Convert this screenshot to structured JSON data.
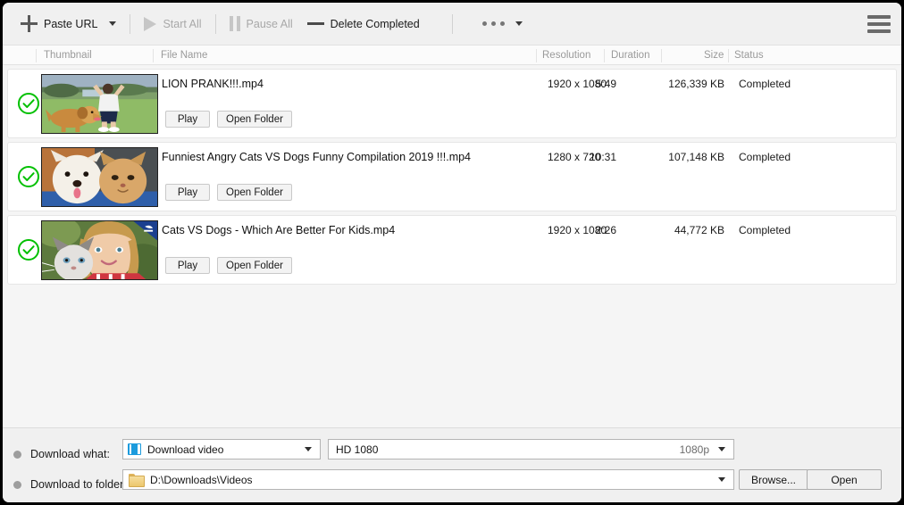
{
  "toolbar": {
    "paste_url": "Paste URL",
    "start_all": "Start All",
    "pause_all": "Pause All",
    "delete_completed": "Delete Completed",
    "plus_icon": "plus-icon",
    "play_icon": "play-icon",
    "pause_icon": "pause-icon",
    "minus_icon": "minus-icon",
    "overflow_icon": "more-dots-icon",
    "menu_icon": "hamburger-menu-icon"
  },
  "columns": {
    "thumbnail": "Thumbnail",
    "file_name": "File Name",
    "resolution": "Resolution",
    "duration": "Duration",
    "size": "Size",
    "status": "Status"
  },
  "row_actions": {
    "play": "Play",
    "open_folder": "Open Folder",
    "status_icon": "check-circle-icon"
  },
  "downloads": [
    {
      "file_name": "LION PRANK!!!.mp4",
      "resolution": "1920 x 1080",
      "duration": "5:49",
      "size": "126,339 KB",
      "status": "Completed",
      "thumbnail_alt": "dog-running-with-person"
    },
    {
      "file_name": "Funniest Angry Cats VS Dogs Funny Compilation 2019 !!!.mp4",
      "resolution": "1280 x 720",
      "duration": "10:31",
      "size": "107,148 KB",
      "status": "Completed",
      "thumbnail_alt": "white-dog-and-ginger-cat"
    },
    {
      "file_name": "Cats VS Dogs - Which Are Better For Kids.mp4",
      "resolution": "1920 x 1080",
      "duration": "2:26",
      "size": "44,772 KB",
      "status": "Completed",
      "thumbnail_alt": "girl-hugging-kitten"
    }
  ],
  "bottom": {
    "download_what_label": "Download what:",
    "download_to_folder_label": "Download to folder:",
    "media_type": "Download video",
    "media_type_icon": "film-strip-icon",
    "quality": "HD 1080",
    "quality_suffix": "1080p",
    "folder_path": "D:\\Downloads\\Videos",
    "folder_icon": "folder-icon",
    "browse": "Browse...",
    "open": "Open"
  },
  "colors": {
    "accent_blue": "#1c9bdd",
    "status_green": "#00c000",
    "window_bg": "#f0f0f0",
    "list_bg": "#f5f5f5"
  }
}
